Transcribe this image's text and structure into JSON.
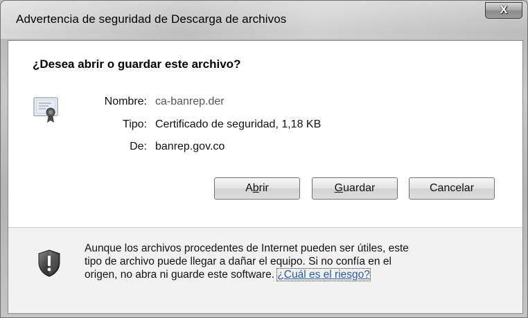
{
  "window": {
    "title": "Advertencia de seguridad de Descarga de archivos",
    "close_label": "X"
  },
  "dialog": {
    "question": "¿Desea abrir o guardar este archivo?",
    "fields": {
      "name_label": "Nombre:",
      "name_value": "ca-banrep.der",
      "type_label": "Tipo:",
      "type_value": "Certificado de seguridad, 1,18 KB",
      "from_label": "De:",
      "from_value": "banrep.gov.co"
    },
    "buttons": {
      "open_pre": "A",
      "open_u": "b",
      "open_post": "rir",
      "save_u": "G",
      "save_post": "uardar",
      "cancel": "Cancelar"
    },
    "warning": {
      "line1": "Aunque los archivos procedentes de Internet pueden ser útiles, este",
      "line2": "tipo de archivo puede llegar a dañar el equipo. Si no confía en el",
      "line3": "origen, no abra ni guarde este software.",
      "link": "¿Cuál es el riesgo?"
    }
  },
  "icons": {
    "certificate": "certificate-icon",
    "shield": "shield-warning-icon",
    "close": "close-icon"
  },
  "colors": {
    "link": "#2a5aa8",
    "value_dim": "#555555"
  }
}
